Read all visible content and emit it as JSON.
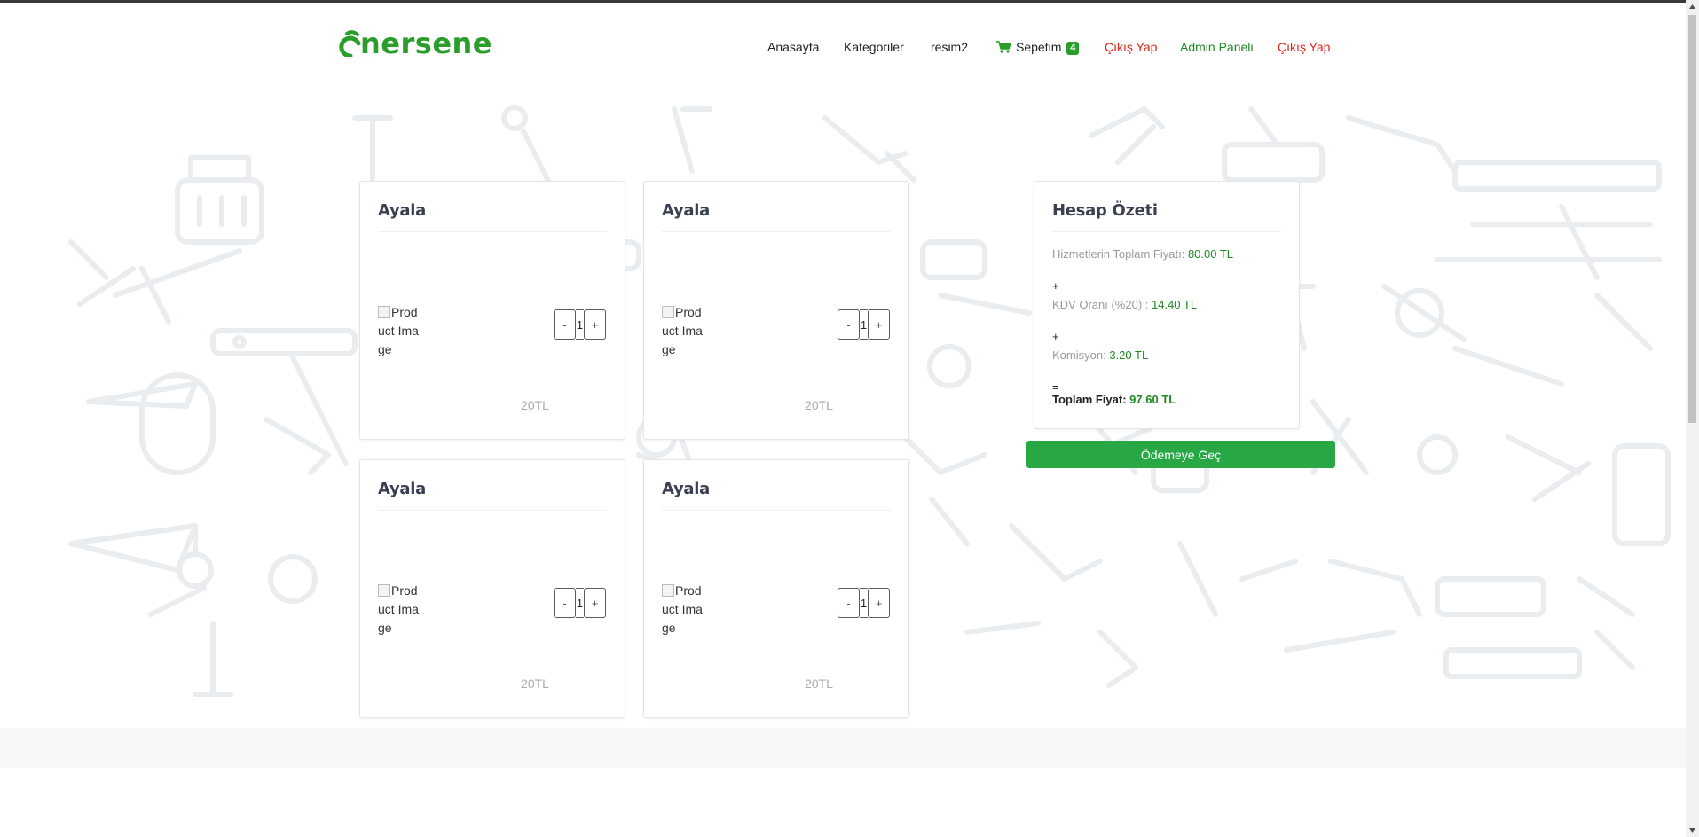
{
  "brand": {
    "logo_text": "nersene",
    "accent": "#2a9d2a"
  },
  "nav": {
    "items": [
      {
        "label": "Anasayfa"
      },
      {
        "label": "Kategoriler"
      },
      {
        "label": "resim2"
      },
      {
        "label": "Sepetim",
        "badge": "4"
      },
      {
        "label": "Çıkış Yap"
      },
      {
        "label": "Admin Paneli"
      },
      {
        "label": "Çıkış Yap"
      }
    ]
  },
  "cart": {
    "items": [
      {
        "title": "Ayala",
        "image_alt": "Product Image",
        "qty": "1",
        "minus": "-",
        "plus": "+",
        "price": "20TL"
      },
      {
        "title": "Ayala",
        "image_alt": "Product Image",
        "qty": "1",
        "minus": "-",
        "plus": "+",
        "price": "20TL"
      },
      {
        "title": "Ayala",
        "image_alt": "Product Image",
        "qty": "1",
        "minus": "-",
        "plus": "+",
        "price": "20TL"
      },
      {
        "title": "Ayala",
        "image_alt": "Product Image",
        "qty": "1",
        "minus": "-",
        "plus": "+",
        "price": "20TL"
      }
    ]
  },
  "summary": {
    "title": "Hesap Özeti",
    "services_label": "Hizmetlerin Toplam Fiyatı:",
    "services_value": "80.00 TL",
    "plus": "+",
    "vat_label": "KDV Oranı (%20) :",
    "vat_value": "14.40 TL",
    "commission_label": "Komisyon:",
    "commission_value": "3.20 TL",
    "equals": "=",
    "total_label": "Toplam Fiyat:",
    "total_value": "97.60 TL",
    "checkout_label": "Ödemeye Geç"
  }
}
